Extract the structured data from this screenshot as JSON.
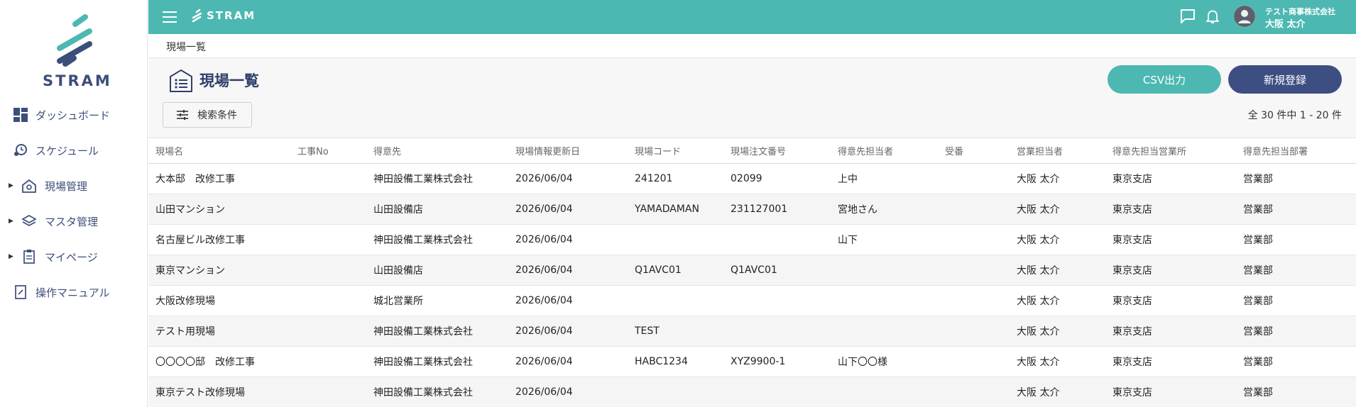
{
  "sidebar": {
    "logo_text": "STRAM",
    "items": [
      {
        "label": "ダッシュボード",
        "icon": "dashboard-icon",
        "expandable": false
      },
      {
        "label": "スケジュール",
        "icon": "schedule-icon",
        "expandable": false
      },
      {
        "label": "現場管理",
        "icon": "site-management-icon",
        "expandable": true
      },
      {
        "label": "マスタ管理",
        "icon": "layers-icon",
        "expandable": true
      },
      {
        "label": "マイページ",
        "icon": "mypage-icon",
        "expandable": true
      },
      {
        "label": "操作マニュアル",
        "icon": "manual-icon",
        "expandable": false
      }
    ]
  },
  "header": {
    "logo_text": "STRAM",
    "company": "テスト商事株式会社",
    "user": "大阪 太介",
    "colors": {
      "bar": "#4db8b2",
      "navy": "#3d4e82"
    }
  },
  "breadcrumb": "現場一覧",
  "page": {
    "title": "現場一覧",
    "csv_label": "CSV出力",
    "new_label": "新規登録",
    "search_label": "検索条件",
    "count_text": "全 30 件中 1 - 20 件"
  },
  "table": {
    "columns": [
      "現場名",
      "工事No",
      "得意先",
      "現場情報更新日",
      "現場コード",
      "現場注文番号",
      "得意先担当者",
      "受番",
      "営業担当者",
      "得意先担当営業所",
      "得意先担当部署"
    ],
    "rows": [
      [
        "大本邸　改修工事",
        "",
        "神田設備工業株式会社",
        "2026/06/04",
        "241201",
        "02099",
        "上中",
        "",
        "大阪 太介",
        "東京支店",
        "営業部"
      ],
      [
        "山田マンション",
        "",
        "山田設備店",
        "2026/06/04",
        "YAMADAMAN",
        "231127001",
        "宮地さん",
        "",
        "大阪 太介",
        "東京支店",
        "営業部"
      ],
      [
        "名古屋ビル改修工事",
        "",
        "神田設備工業株式会社",
        "2026/06/04",
        "",
        "",
        "山下",
        "",
        "大阪 太介",
        "東京支店",
        "営業部"
      ],
      [
        "東京マンション",
        "",
        "山田設備店",
        "2026/06/04",
        "Q1AVC01",
        "Q1AVC01",
        "",
        "",
        "大阪 太介",
        "東京支店",
        "営業部"
      ],
      [
        "大阪改修現場",
        "",
        "城北営業所",
        "2026/06/04",
        "",
        "",
        "",
        "",
        "大阪 太介",
        "東京支店",
        "営業部"
      ],
      [
        "テスト用現場",
        "",
        "神田設備工業株式会社",
        "2026/06/04",
        "TEST",
        "",
        "",
        "",
        "大阪 太介",
        "東京支店",
        "営業部"
      ],
      [
        "〇〇〇〇邸　改修工事",
        "",
        "神田設備工業株式会社",
        "2026/06/04",
        "HABC1234",
        "XYZ9900-1",
        "山下〇〇様",
        "",
        "大阪 太介",
        "東京支店",
        "営業部"
      ],
      [
        "東京テスト改修現場",
        "",
        "神田設備工業株式会社",
        "2026/06/04",
        "",
        "",
        "",
        "",
        "大阪 太介",
        "東京支店",
        "営業部"
      ]
    ]
  }
}
